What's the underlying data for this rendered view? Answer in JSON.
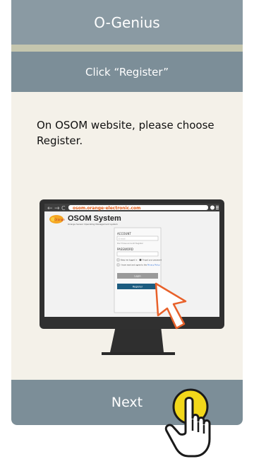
{
  "header": {
    "title": "O-Genius"
  },
  "step": {
    "title": "Click “Register”"
  },
  "instruction": {
    "text": "On OSOM website, please choose Register."
  },
  "browser": {
    "url": "osom.orange-electronic.com",
    "logo_text": "Orange",
    "system_title": "OSOM System",
    "system_subtitle": "Orange Sensor Operating Management system",
    "login_form": {
      "account_label": "ACCOUNT",
      "email_placeholder": "E-mail",
      "hint_text": "Don't have account? Register",
      "password_label": "PASSWORD",
      "remember_label": "Keep me logged in",
      "forgot_label": "Forgot your password",
      "agree_prefix": "I have read and agree to the ",
      "privacy_link": "Privacy Policy",
      "login_label": "Login",
      "register_label": "Register"
    }
  },
  "footer": {
    "next_label": "Next"
  },
  "colors": {
    "header": "#8a9aa3",
    "step_bar": "#7c8e98",
    "card": "#f4f1e9",
    "url_text": "#e35a15",
    "register_button": "#1c5c80",
    "cursor": "#e8612a",
    "tap_circle": "#f2d71a"
  },
  "icons": [
    "back-arrow-icon",
    "forward-arrow-icon",
    "refresh-icon",
    "profile-icon",
    "menu-icon",
    "orange-logo-icon",
    "pointer-cursor-icon",
    "hand-pointer-icon"
  ]
}
